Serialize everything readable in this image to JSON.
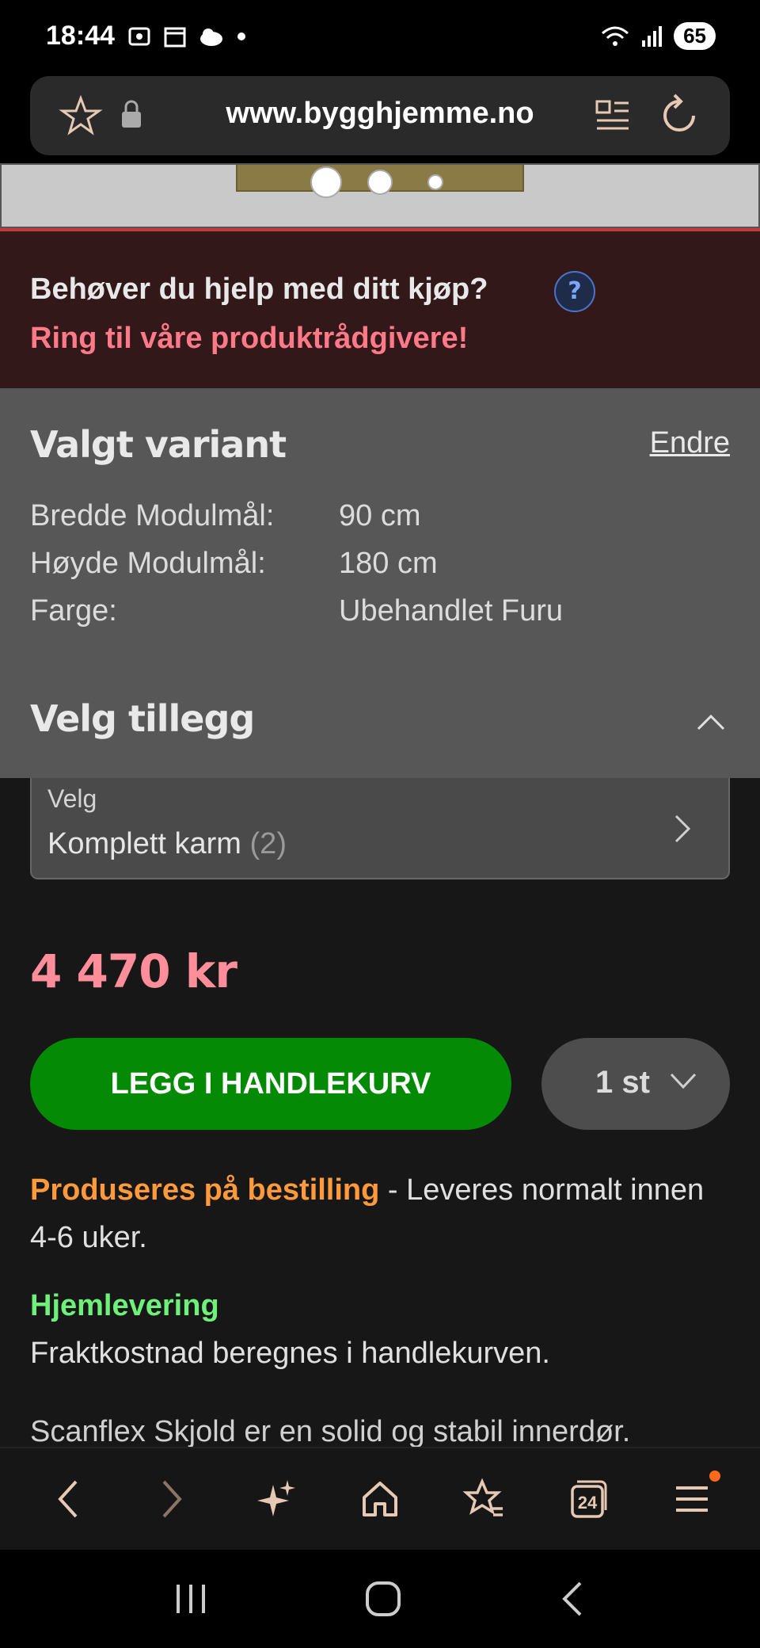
{
  "status_bar": {
    "time": "18:44",
    "battery": "65",
    "network": "5"
  },
  "address_bar": {
    "url": "www.bygghjemme.no"
  },
  "help_banner": {
    "title": "Behøver du hjelp med ditt kjøp?",
    "subtitle": "Ring til våre produktrådgivere!",
    "help_icon": "?"
  },
  "variant": {
    "title": "Valgt variant",
    "change_label": "Endre",
    "specs": [
      {
        "label": "Bredde Modulmål:",
        "value": "90 cm"
      },
      {
        "label": "Høyde Modulmål:",
        "value": "180 cm"
      },
      {
        "label": "Farge:",
        "value": "Ubehandlet Furu"
      }
    ]
  },
  "addons": {
    "title": "Velg tillegg",
    "select_label": "Velg",
    "select_value": "Komplett karm",
    "select_count": "(2)"
  },
  "price": "4 470 kr",
  "cart": {
    "add_label": "LEGG I HANDLEKURV",
    "quantity": "1 st"
  },
  "delivery": {
    "status_highlight": "Produseres på bestilling",
    "status_text": " - Leveres normalt innen 4-6 uker.",
    "home_title": "Hjemlevering",
    "home_text": "Fraktkostnad beregnes i handlekurven."
  },
  "description_preview": "Scanflex Skjold er en solid og stabil innerdør.",
  "toolbar": {
    "tabs_count": "24"
  },
  "colors": {
    "accent_green": "#048a04",
    "price_pink": "#ff8e9a",
    "warning_orange": "#ff9a3c",
    "success_green": "#6ef07a"
  },
  "icons": [
    "star-icon",
    "lock-icon",
    "reader-icon",
    "reload-icon",
    "back-icon",
    "forward-icon",
    "sparkle-icon",
    "home-icon",
    "favorites-icon",
    "tabs-icon",
    "menu-icon"
  ]
}
